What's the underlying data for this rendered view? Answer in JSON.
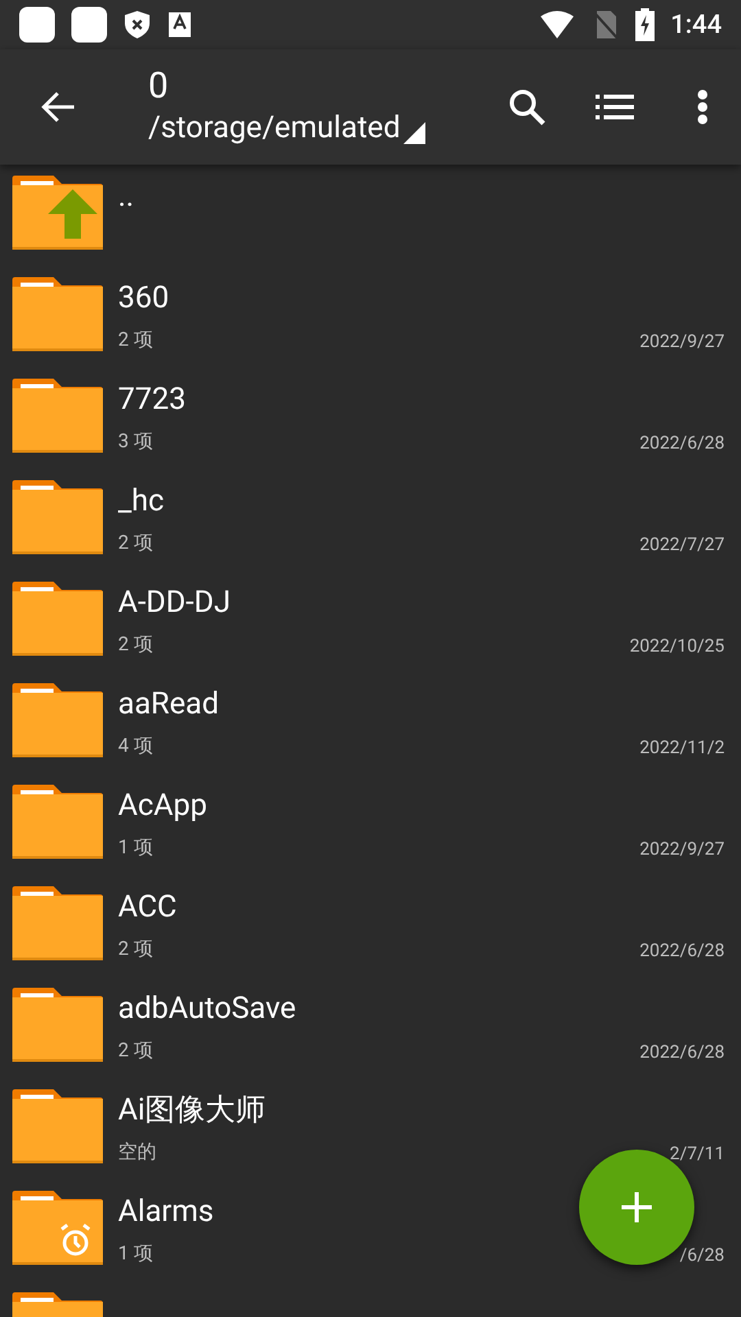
{
  "status_bar": {
    "time": "1:44"
  },
  "toolbar": {
    "title": "0",
    "path": "/storage/emulated"
  },
  "files": [
    {
      "kind": "parent",
      "name": ".."
    },
    {
      "kind": "folder",
      "name": "360",
      "info": "2 项",
      "date": "2022/9/27"
    },
    {
      "kind": "folder",
      "name": "7723",
      "info": "3 项",
      "date": "2022/6/28"
    },
    {
      "kind": "folder",
      "name": "_hc",
      "info": "2 项",
      "date": "2022/7/27"
    },
    {
      "kind": "folder",
      "name": "A-DD-DJ",
      "info": "2 项",
      "date": "2022/10/25"
    },
    {
      "kind": "folder",
      "name": "aaRead",
      "info": "4 项",
      "date": "2022/11/2"
    },
    {
      "kind": "folder",
      "name": "AcApp",
      "info": "1 项",
      "date": "2022/9/27"
    },
    {
      "kind": "folder",
      "name": "ACC",
      "info": "2 项",
      "date": "2022/6/28"
    },
    {
      "kind": "folder",
      "name": "adbAutoSave",
      "info": "2 项",
      "date": "2022/6/28"
    },
    {
      "kind": "folder",
      "name": "Ai图像大师",
      "info": "空的",
      "date": "2/7/11"
    },
    {
      "kind": "alarm",
      "name": "Alarms",
      "info": "1 项",
      "date": "/6/28"
    },
    {
      "kind": "folder"
    }
  ]
}
